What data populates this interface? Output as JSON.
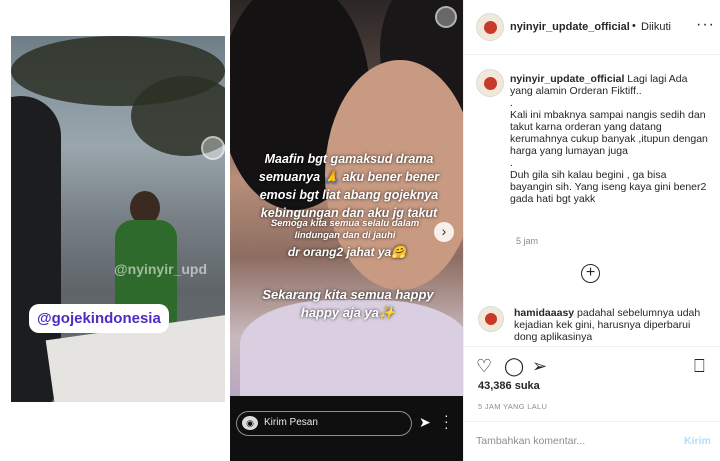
{
  "media": {
    "story1": {
      "watermark": "@nyinyir_upd",
      "tag": "@gojekindonesia"
    },
    "story2": {
      "text1": "Maafin bgt gamaksud drama semuanya 🙏 aku bener bener emosi bgt liat abang gojeknya kebingungan dan aku jg takut",
      "text2": "Semoga kita semua selalu dalam lindungan dan di jauhi",
      "text3": "dr orang2 jahat ya🤗",
      "text4": "Sekarang kita semua happy happy aja ya✨",
      "reply_placeholder": "Kirim Pesan",
      "next_arrow": "›"
    }
  },
  "header": {
    "username": "nyinyir_update_official",
    "dot": "•",
    "follow_status": "Diikuti",
    "more": "···"
  },
  "caption": {
    "username": "nyinyir_update_official",
    "lines": [
      "Lagi lagi Ada yang alamin Orderan Fiktiff..",
      ".",
      "Kali ini mbaknya sampai nangis sedih dan takut karna orderan yang datang kerumahnya cukup banyak ,itupun dengan harga yang lumayan juga",
      ".",
      "Duh gila sih kalau begini , ga bisa bayangin sih. Yang iseng kaya gini bener2 gada hati bgt yakk"
    ],
    "time": "5 jam"
  },
  "load_more": "+",
  "comment": {
    "username": "hamidaaasy",
    "text": "padahal sebelumnya udah kejadian kek gini, harusnya diperbarui dong aplikasinya"
  },
  "actions": {
    "like_icon": "♡",
    "comment_icon": "◯",
    "share_icon": "➢",
    "save_icon": "⎕"
  },
  "likes": "43,386 suka",
  "date": "5 JAM YANG LALU",
  "add_comment": {
    "placeholder": "Tambahkan komentar...",
    "post_label": "Kirim"
  }
}
